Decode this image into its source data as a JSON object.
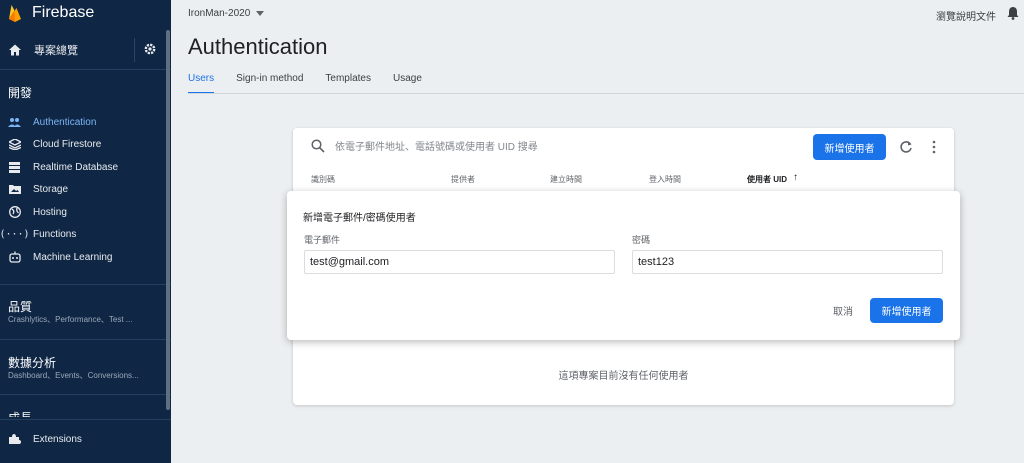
{
  "app": {
    "brand": "Firebase"
  },
  "sidebar": {
    "overview": "專案總覽",
    "develop": {
      "title": "開發",
      "items": [
        {
          "label": "Authentication",
          "icon": "users-icon",
          "active": true
        },
        {
          "label": "Cloud Firestore",
          "icon": "firestore-icon"
        },
        {
          "label": "Realtime Database",
          "icon": "database-icon"
        },
        {
          "label": "Storage",
          "icon": "image-folder-icon"
        },
        {
          "label": "Hosting",
          "icon": "globe-icon"
        },
        {
          "label": "Functions",
          "icon": "code-icon"
        },
        {
          "label": "Machine Learning",
          "icon": "robot-icon"
        }
      ]
    },
    "quality": {
      "title": "品質",
      "subtitle": "Crashlytics、Performance、Test ..."
    },
    "analytics": {
      "title": "數據分析",
      "subtitle": "Dashboard、Events、Conversions..."
    },
    "grow": {
      "title": "成長"
    },
    "extensions": "Extensions"
  },
  "header": {
    "project": "IronMan-2020",
    "docs": "瀏覽說明文件"
  },
  "page": {
    "title": "Authentication",
    "tabs": [
      "Users",
      "Sign-in method",
      "Templates",
      "Usage"
    ]
  },
  "users": {
    "search_placeholder": "依電子郵件地址、電話號碼或使用者 UID 搜尋",
    "add_user": "新增使用者",
    "columns": [
      "識別碼",
      "提供者",
      "建立時間",
      "登入時間",
      "使用者 UID"
    ],
    "empty": "這項專案目前沒有任何使用者"
  },
  "dialog": {
    "title": "新增電子郵件/密碼使用者",
    "email_label": "電子郵件",
    "email_value": "test@gmail.com",
    "password_label": "密碼",
    "password_value": "test123",
    "cancel": "取消",
    "submit": "新增使用者"
  },
  "colors": {
    "sidebar_bg": "#0f2745",
    "accent": "#1a73e8",
    "active_nav": "#7cb5f5"
  }
}
